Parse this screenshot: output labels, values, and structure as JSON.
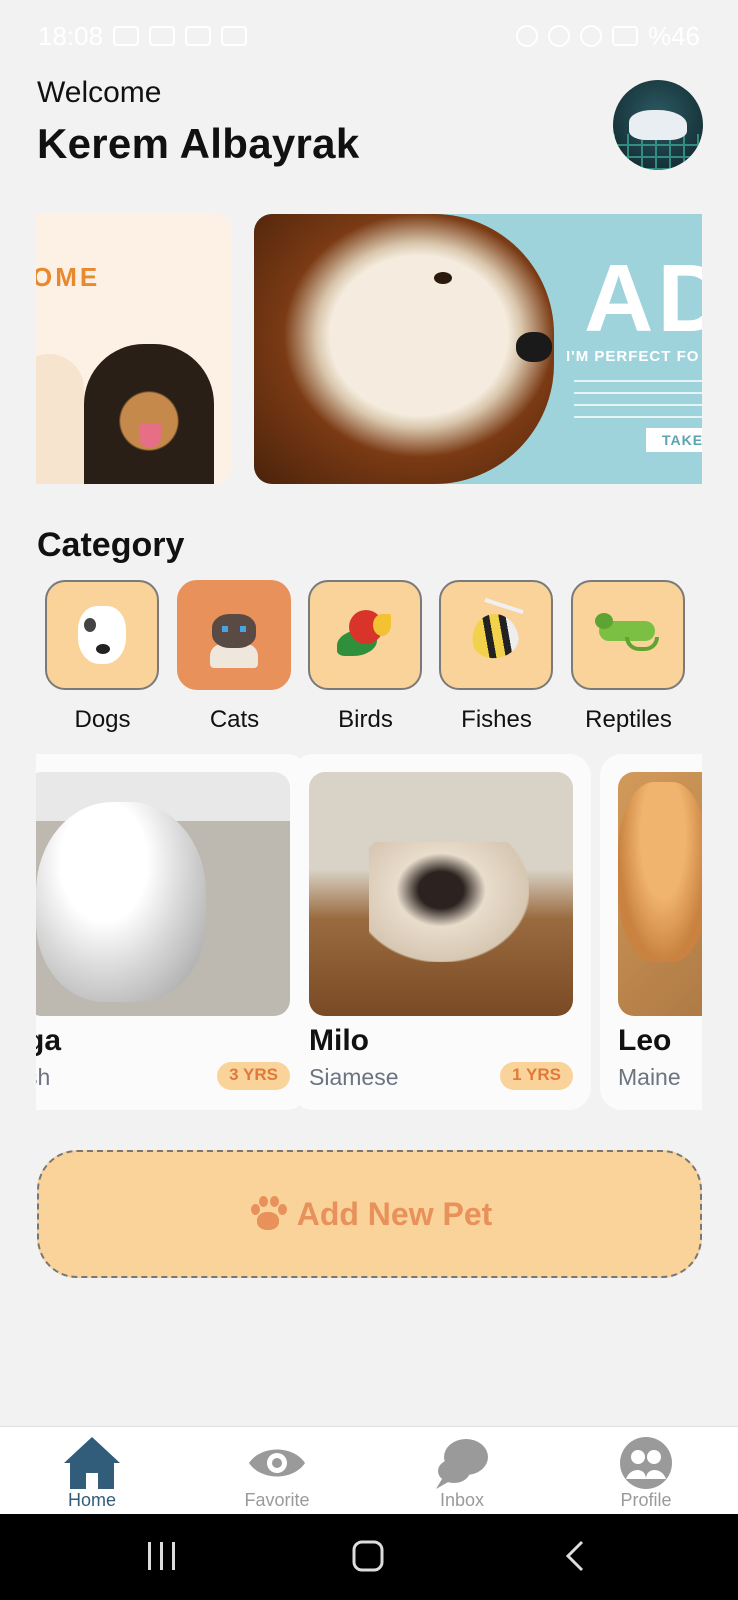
{
  "status_bar": {
    "time": "18:08",
    "battery": "%46"
  },
  "header": {
    "welcome": "Welcome",
    "user_name": "Kerem Albayrak"
  },
  "banners": [
    {
      "title": "OME"
    },
    {
      "big_text": "AD",
      "subtitle": "I'M PERFECT FO",
      "button": "TAKE"
    }
  ],
  "category": {
    "title": "Category",
    "items": [
      {
        "label": "Dogs",
        "icon": "dog-icon",
        "selected": false
      },
      {
        "label": "Cats",
        "icon": "cat-icon",
        "selected": true
      },
      {
        "label": "Birds",
        "icon": "parrot-icon",
        "selected": false
      },
      {
        "label": "Fishes",
        "icon": "fish-icon",
        "selected": false
      },
      {
        "label": "Reptiles",
        "icon": "iguana-icon",
        "selected": false
      }
    ]
  },
  "pets": [
    {
      "name": "ga",
      "breed": "sh",
      "age": "3 YRS"
    },
    {
      "name": "Milo",
      "breed": "Siamese",
      "age": "1 YRS"
    },
    {
      "name": "Leo",
      "breed": "Maine",
      "age": ""
    }
  ],
  "add_pet": {
    "label": "Add New Pet",
    "icon": "paw-icon"
  },
  "bottom_nav": {
    "items": [
      {
        "label": "Home",
        "icon": "home-icon",
        "active": true
      },
      {
        "label": "Favorite",
        "icon": "eye-icon",
        "active": false
      },
      {
        "label": "Inbox",
        "icon": "chat-icon",
        "active": false
      },
      {
        "label": "Profile",
        "icon": "profile-icon",
        "active": false
      }
    ]
  },
  "colors": {
    "accent": "#e8915a",
    "card_bg": "#f9d39a",
    "nav_active": "#315c7a",
    "nav_inactive": "#9a9a9a"
  }
}
